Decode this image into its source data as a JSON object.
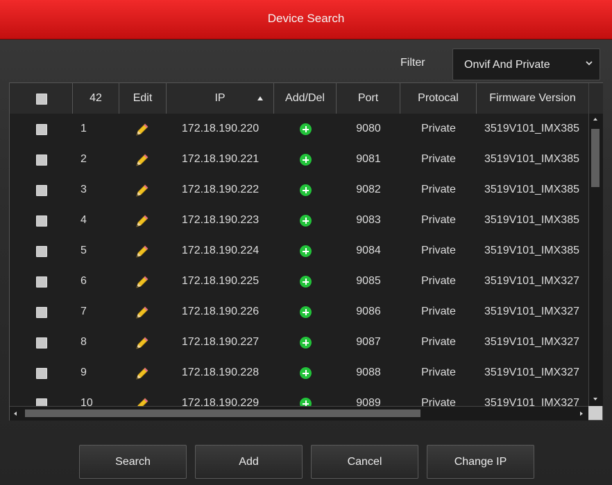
{
  "dialog": {
    "title": "Device Search"
  },
  "filter": {
    "label": "Filter",
    "value": "Onvif And Private",
    "icon": "chevron-down-icon"
  },
  "table": {
    "columns": [
      "",
      "42",
      "Edit",
      "IP",
      "Add/Del",
      "Port",
      "Protocal",
      "Firmware Version"
    ],
    "sort": {
      "column": "IP",
      "direction": "ascending"
    },
    "rows": [
      {
        "no": "1",
        "ip": "172.18.190.220",
        "port": "9080",
        "protocol": "Private",
        "firmware": "3519V101_IMX385"
      },
      {
        "no": "2",
        "ip": "172.18.190.221",
        "port": "9081",
        "protocol": "Private",
        "firmware": "3519V101_IMX385"
      },
      {
        "no": "3",
        "ip": "172.18.190.222",
        "port": "9082",
        "protocol": "Private",
        "firmware": "3519V101_IMX385"
      },
      {
        "no": "4",
        "ip": "172.18.190.223",
        "port": "9083",
        "protocol": "Private",
        "firmware": "3519V101_IMX385"
      },
      {
        "no": "5",
        "ip": "172.18.190.224",
        "port": "9084",
        "protocol": "Private",
        "firmware": "3519V101_IMX385"
      },
      {
        "no": "6",
        "ip": "172.18.190.225",
        "port": "9085",
        "protocol": "Private",
        "firmware": "3519V101_IMX327"
      },
      {
        "no": "7",
        "ip": "172.18.190.226",
        "port": "9086",
        "protocol": "Private",
        "firmware": "3519V101_IMX327"
      },
      {
        "no": "8",
        "ip": "172.18.190.227",
        "port": "9087",
        "protocol": "Private",
        "firmware": "3519V101_IMX327"
      },
      {
        "no": "9",
        "ip": "172.18.190.228",
        "port": "9088",
        "protocol": "Private",
        "firmware": "3519V101_IMX327"
      },
      {
        "no": "10",
        "ip": "172.18.190.229",
        "port": "9089",
        "protocol": "Private",
        "firmware": "3519V101_IMX327"
      }
    ]
  },
  "buttons": {
    "search": "Search",
    "add": "Add",
    "cancel": "Cancel",
    "change_ip": "Change IP"
  },
  "colors": {
    "title_bar": "#e01b1b",
    "add_icon": "#22c33a",
    "pencil": "#f0c020"
  }
}
